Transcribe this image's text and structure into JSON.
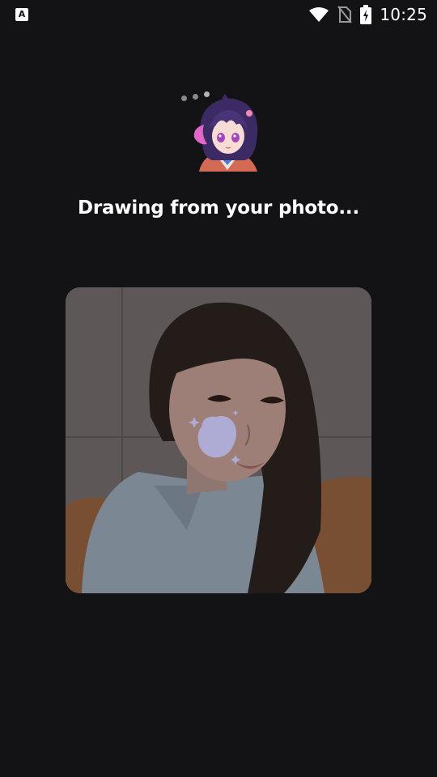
{
  "status_bar": {
    "app_icon_glyph": "A",
    "time": "10:25",
    "icons": [
      "wifi-icon",
      "no-sim-icon",
      "battery-charging-icon"
    ]
  },
  "loading": {
    "headline": "Drawing from your photo...",
    "indicator": "loading-dots-icon",
    "avatar_icon": "anime-girl-avatar-icon"
  },
  "photo": {
    "overlay_icon": "paint-blob-sparkle-icon",
    "accent_color": "#c7c3f2"
  }
}
